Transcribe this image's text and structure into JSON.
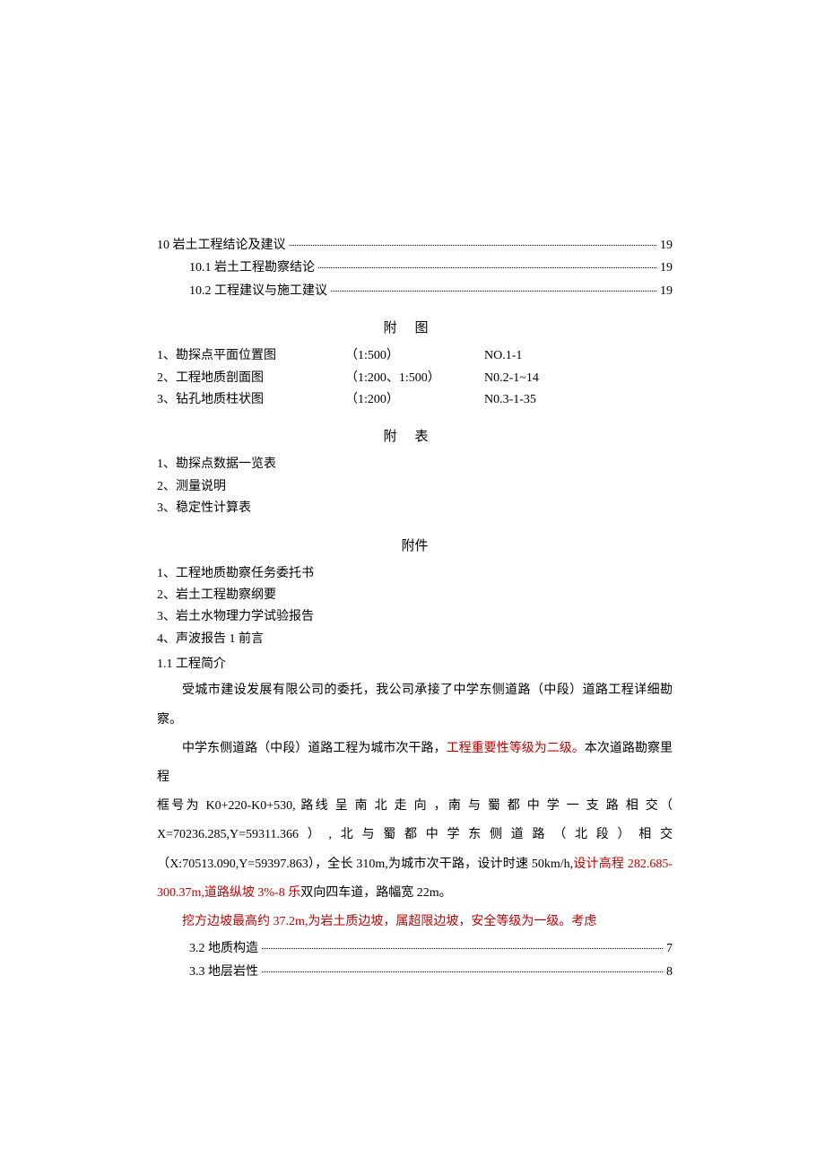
{
  "toc1": {
    "label": "10 岩土工程结论及建议",
    "page": "19"
  },
  "toc1_1": {
    "label": "10.1 岩土工程勘察结论",
    "page": "19"
  },
  "toc1_2": {
    "label": "10.2 工程建议与施工建议",
    "page": "19"
  },
  "figures_title": "附图",
  "figures": [
    {
      "c1": "1、勘探点平面位置图",
      "c2": "（1:500）",
      "c3": "NO.1-1"
    },
    {
      "c1": "2、工程地质剖面图",
      "c2": "（1:200、1:500）",
      "c3": "N0.2-1~14"
    },
    {
      "c1": "3、钻孔地质柱状图",
      "c2": "（1:200）",
      "c3": "N0.3-1-35"
    }
  ],
  "tables_title": "附表",
  "tables": [
    "1、勘探点数据一览表",
    "2、测量说明",
    "3、稳定性计算表"
  ],
  "attachments_title": "附件",
  "attachments": [
    "1、工程地质勘察任务委托书",
    "2、岩土工程勘察纲要",
    "3、岩土水物理力学试验报告",
    "4、声波报告 1 前言"
  ],
  "heading11": "1.1 工程简介",
  "p1": "受城市建设发展有限公司的委托，我公司承接了中学东侧道路（中段）道路工程详细勘察。",
  "p2_a": "中学东侧道路（中段）道路工程为城市次干路，",
  "p2_red": "工程重要性等级为二级。",
  "p2_b_line1": "本次道路勘察里程",
  "p2_b_line2": "框号为 K0+220-K0+530, 路线 呈 南 北 走 向 ，南 与 蜀 都 中 学 一 支 路 相 交（",
  "p2_c": "X=70236.285,Y=59311.366）,北与蜀都中学东侧道路（北段）相交（X:70513.090,Y=59397.863），全长 310m,为城市次干路，设计时速 50km/h,",
  "p2_red2": "设计高程 282.685-300.37m,道路纵坡 3%-8 乐",
  "p2_d": "双向四车道，路幅宽 22m。",
  "p3_red": "挖方边坡最高约 37.2m,为岩土质边坡，属超限边坡，安全等级为一级。考虑",
  "toc2": {
    "label": "3.2 地质构造",
    "page": "7"
  },
  "toc3": {
    "label": "3.3 地层岩性",
    "page": "8"
  }
}
